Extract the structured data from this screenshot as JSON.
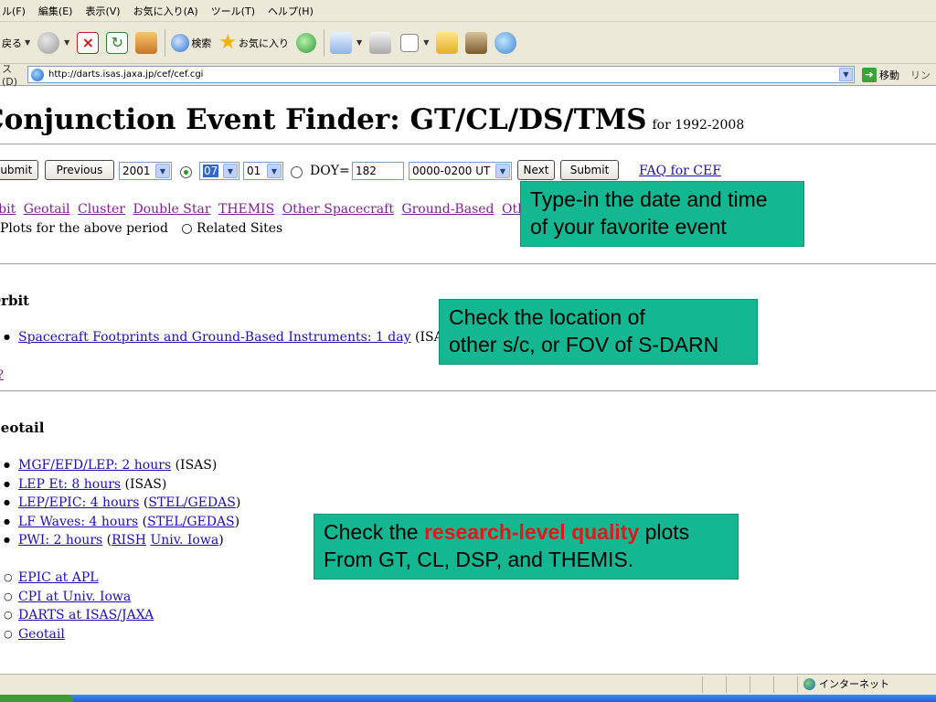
{
  "browser": {
    "menu": [
      "ル(F)",
      "編集(E)",
      "表示(V)",
      "お気に入り(A)",
      "ツール(T)",
      "ヘルプ(H)"
    ],
    "toolbar": {
      "back_label": "戻る",
      "search_label": "検索",
      "favorites_label": "お気に入り"
    },
    "address_label": "ス(D)",
    "url": "http://darts.isas.jaxa.jp/cef/cef.cgi",
    "go_label": "移動",
    "links_label": "リン",
    "status_zone": "インターネット"
  },
  "page": {
    "title": "Conjunction Event Finder: GT/CL/DS/TMS",
    "title_sub": "for 1992-2008",
    "form": {
      "submit_left": "Submit",
      "previous": "Previous",
      "year": "2001",
      "month": "07",
      "day": "01",
      "doy_label": "DOY=",
      "doy_value": "182",
      "time_range": "0000-0200 UT",
      "next": "Next",
      "submit_right": "Submit",
      "faq": "FAQ for CEF"
    },
    "nav_links": [
      "Orbit",
      "Geotail",
      "Cluster",
      "Double Star",
      "THEMIS",
      "Other Spacecraft",
      "Ground-Based",
      "Other Data"
    ],
    "radio_plots": "Plots for the above period",
    "radio_related": "Related Sites",
    "orbit": {
      "heading": "Orbit",
      "link": "Spacecraft Footprints and Ground-Based Instruments: 1 day",
      "suffix": " (ISAS)",
      "top_link": "?"
    },
    "geotail": {
      "heading": "Geotail",
      "items": [
        {
          "link": "MGF/EFD/LEP: 2 hours",
          "suffix": " (ISAS)"
        },
        {
          "link": "LEP Et: 8 hours",
          "suffix": " (ISAS)"
        },
        {
          "link": "LEP/EPIC: 4 hours",
          "suffix_pre": " (",
          "suffix_link": "STEL/GEDAS",
          "suffix_post": ")"
        },
        {
          "link": "LF Waves: 4 hours",
          "suffix_pre": " (",
          "suffix_link": "STEL/GEDAS",
          "suffix_post": ")"
        },
        {
          "link": "PWI: 2 hours",
          "suffix_pre": " (",
          "suffix_link": "RISH",
          "suffix_link2": "Univ. Iowa",
          "suffix_post": ")"
        }
      ],
      "sites": [
        "EPIC at APL",
        "CPI at Univ. Iowa",
        "DARTS at ISAS/JAXA",
        "Geotail"
      ]
    }
  },
  "callouts": {
    "datetime": [
      "Type-in the date and time",
      "of your favorite event"
    ],
    "location": [
      "Check the location of",
      "other s/c, or FOV of S-DARN"
    ],
    "quality_pre": "Check the ",
    "quality_em": "research-level quality",
    "quality_post": " plots",
    "quality_line2": "From GT, CL, DSP, and THEMIS."
  },
  "colors": {
    "callout_bg": "#13b892",
    "callout_emphasis": "#e8141a",
    "link": "#1b0fb5",
    "visited_link": "#7a2290"
  }
}
